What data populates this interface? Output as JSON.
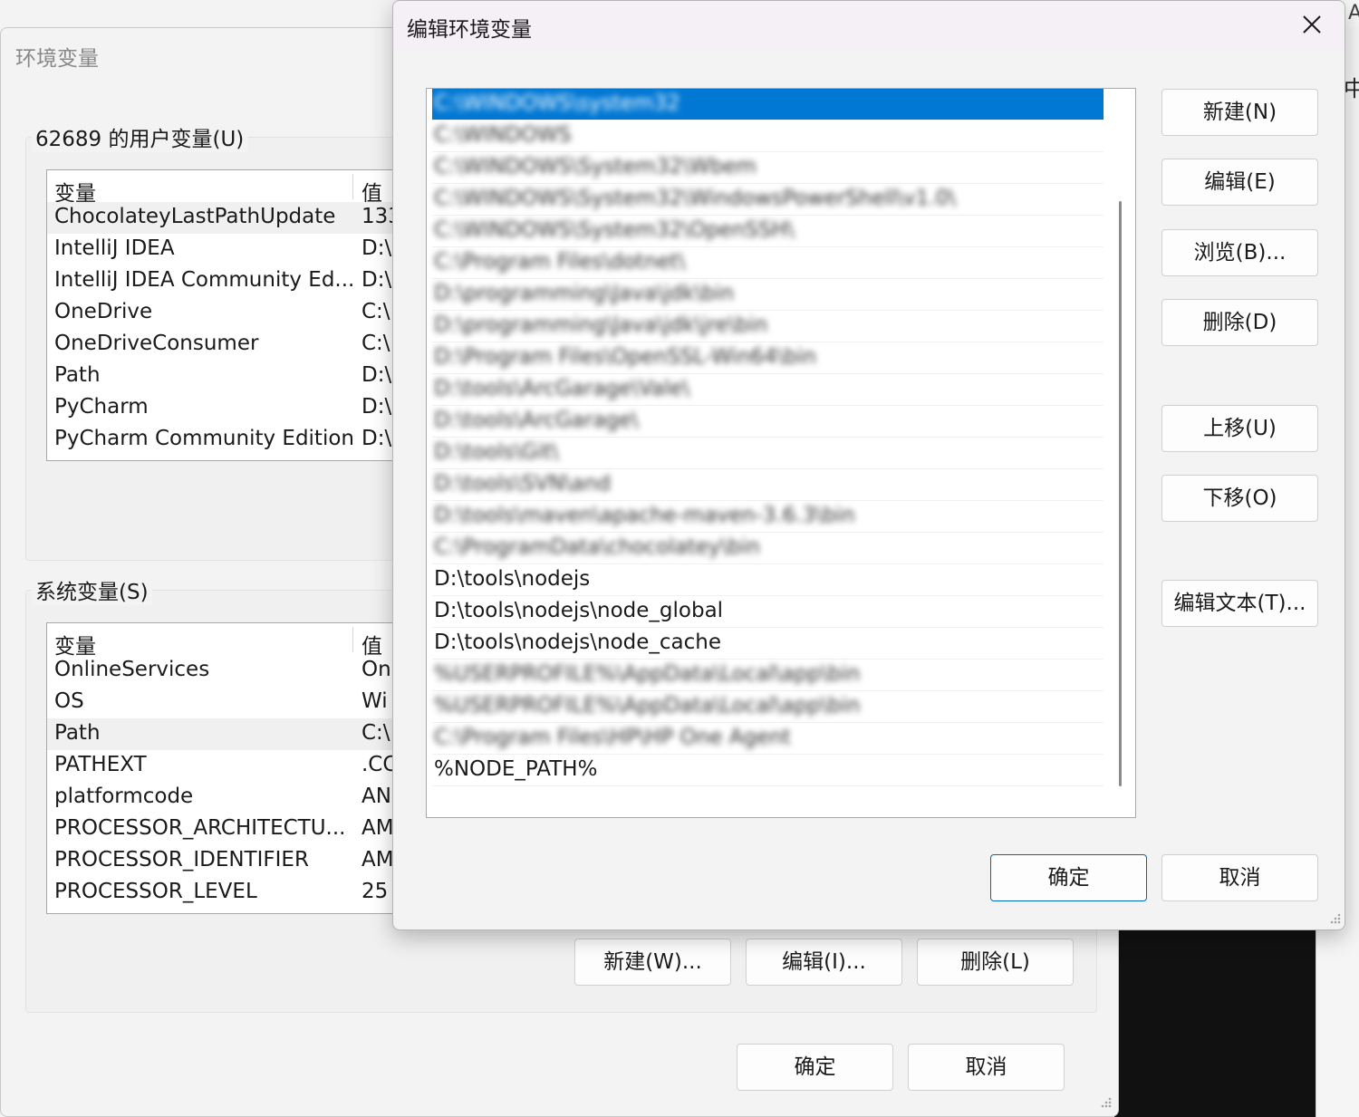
{
  "env_window": {
    "title": "环境变量",
    "user_section": {
      "label": "62689 的用户变量(U)",
      "headers": {
        "name": "变量",
        "value": "值"
      },
      "rows": [
        {
          "name": "ChocolateyLastPathUpdate",
          "value": "133"
        },
        {
          "name": "IntelliJ IDEA",
          "value": "D:\\"
        },
        {
          "name": "IntelliJ IDEA Community Ed...",
          "value": "D:\\"
        },
        {
          "name": "OneDrive",
          "value": "C:\\"
        },
        {
          "name": "OneDriveConsumer",
          "value": "C:\\"
        },
        {
          "name": "Path",
          "value": "D:\\"
        },
        {
          "name": "PyCharm",
          "value": "D:\\"
        },
        {
          "name": "PyCharm Community Edition",
          "value": "D:\\"
        }
      ]
    },
    "system_section": {
      "label": "系统变量(S)",
      "headers": {
        "name": "变量",
        "value": "值"
      },
      "rows": [
        {
          "name": "OnlineServices",
          "value": "On"
        },
        {
          "name": "OS",
          "value": "Wi"
        },
        {
          "name": "Path",
          "value": "C:\\"
        },
        {
          "name": "PATHEXT",
          "value": ".CC"
        },
        {
          "name": "platformcode",
          "value": "AN"
        },
        {
          "name": "PROCESSOR_ARCHITECTU...",
          "value": "AM"
        },
        {
          "name": "PROCESSOR_IDENTIFIER",
          "value": "AM"
        },
        {
          "name": "PROCESSOR_LEVEL",
          "value": "25"
        }
      ],
      "buttons": {
        "new": "新建(W)...",
        "edit": "编辑(I)...",
        "delete": "删除(L)"
      }
    },
    "ok": "确定",
    "cancel": "取消"
  },
  "edit_dialog": {
    "title": "编辑环境变量",
    "paths": [
      "C:\\WINDOWS\\system32",
      "C:\\WINDOWS",
      "C:\\WINDOWS\\System32\\Wbem",
      "C:\\WINDOWS\\System32\\WindowsPowerShell\\v1.0\\",
      "C:\\WINDOWS\\System32\\OpenSSH\\",
      "C:\\Program Files\\dotnet\\",
      "D:\\programming\\Java\\jdk\\bin",
      "D:\\programming\\Java\\jdk\\jre\\bin",
      "D:\\Program Files\\OpenSSL-Win64\\bin",
      "D:\\tools\\ArcGarage\\Vale\\",
      "D:\\tools\\ArcGarage\\",
      "D:\\tools\\Git\\",
      "D:\\tools\\SVN\\and",
      "D:\\tools\\maven\\apache-maven-3.6.3\\bin",
      "C:\\ProgramData\\chocolatey\\bin",
      "D:\\tools\\nodejs",
      "D:\\tools\\nodejs\\node_global",
      "D:\\tools\\nodejs\\node_cache",
      "%USERPROFILE%\\AppData\\Local\\app\\bin",
      "%USERPROFILE%\\AppData\\Local\\app\\bin",
      "C:\\Program Files\\HP\\HP One Agent",
      "%NODE_PATH%"
    ],
    "buttons": {
      "new": "新建(N)",
      "edit": "编辑(E)",
      "browse": "浏览(B)...",
      "delete": "删除(D)",
      "move_up": "上移(U)",
      "move_down": "下移(O)",
      "edit_text": "编辑文本(T)..."
    },
    "ok": "确定",
    "cancel": "取消"
  },
  "background_fragments": [
    "A",
    "中"
  ]
}
